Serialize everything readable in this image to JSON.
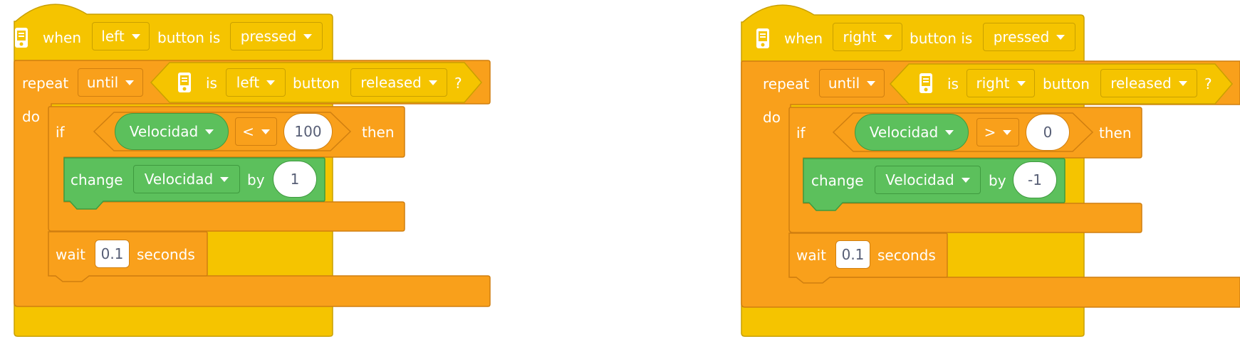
{
  "left_script": {
    "hat": {
      "when": "when",
      "button_dropdown": "left",
      "button_is": "button is",
      "state_dropdown": "pressed",
      "icon": "brain-device-icon"
    },
    "repeat": {
      "label": "repeat",
      "mode_dropdown": "until",
      "do_label": "do"
    },
    "condition": {
      "is": "is",
      "button_dropdown": "left",
      "button": "button",
      "state_dropdown": "released",
      "question": "?",
      "icon": "brain-device-icon"
    },
    "if_block": {
      "if": "if",
      "then": "then",
      "variable": "Velocidad",
      "operator": "<",
      "value": "100"
    },
    "change": {
      "label": "change",
      "variable": "Velocidad",
      "by": "by",
      "value": "1"
    },
    "wait": {
      "label": "wait",
      "value": "0.1",
      "unit": "seconds"
    }
  },
  "right_script": {
    "hat": {
      "when": "when",
      "button_dropdown": "right",
      "button_is": "button is",
      "state_dropdown": "pressed",
      "icon": "brain-device-icon"
    },
    "repeat": {
      "label": "repeat",
      "mode_dropdown": "until",
      "do_label": "do"
    },
    "condition": {
      "is": "is",
      "button_dropdown": "right",
      "button": "button",
      "state_dropdown": "released",
      "question": "?",
      "icon": "brain-device-icon"
    },
    "if_block": {
      "if": "if",
      "then": "then",
      "variable": "Velocidad",
      "operator": ">",
      "value": "0"
    },
    "change": {
      "label": "change",
      "variable": "Velocidad",
      "by": "by",
      "value": "-1"
    },
    "wait": {
      "label": "wait",
      "value": "0.1",
      "unit": "seconds"
    }
  },
  "colors": {
    "events_yellow": "#f5c400",
    "control_orange": "#f9a01b",
    "variables_green": "#5cc05c",
    "text_white": "#ffffff",
    "input_text": "#575e75"
  }
}
